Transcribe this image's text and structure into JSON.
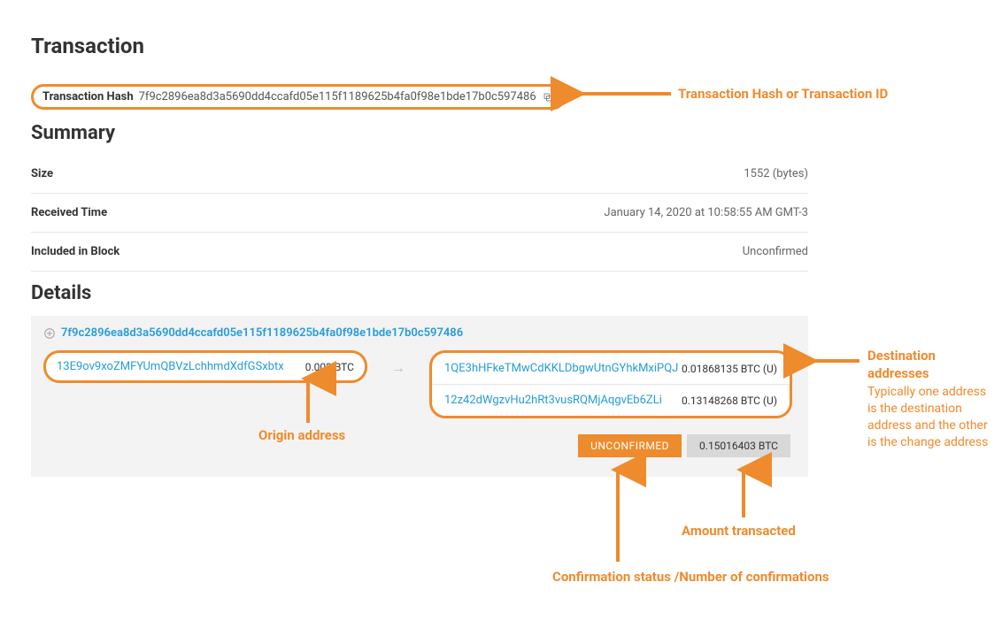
{
  "page_title": "Transaction",
  "hash": {
    "label": "Transaction Hash",
    "value": "7f9c2896ea8d3a5690dd4ccafd05e115f1189625b4fa0f98e1bde17b0c597486"
  },
  "summary": {
    "title": "Summary",
    "rows": [
      {
        "k": "Size",
        "v": "1552 (bytes)"
      },
      {
        "k": "Received Time",
        "v": "January 14, 2020 at 10:58:55 AM GMT-3"
      },
      {
        "k": "Included in Block",
        "v": "Unconfirmed"
      }
    ]
  },
  "details": {
    "title": "Details",
    "tx_link": "7f9c2896ea8d3a5690dd4ccafd05e115f1189625b4fa0f98e1bde17b0c597486",
    "input": {
      "address": "13E9ov9xoZMFYUmQBVzLchhmdXdfGSxbtx",
      "amount": "0.003 BTC"
    },
    "outputs": [
      {
        "address": "1QE3hHFkeTMwCdKKLDbgwUtnGYhkMxiPQJ",
        "amount": "0.01868135 BTC (U)"
      },
      {
        "address": "12z42dWgzvHu2hRt3vusRQMjAqgvEb6ZLi",
        "amount": "0.13148268 BTC (U)"
      }
    ],
    "status_label": "UNCONFIRMED",
    "total_amount": "0.15016403 BTC"
  },
  "callouts": {
    "hash": "Transaction Hash or Transaction ID",
    "origin": "Origin address",
    "dest_title": "Destination addresses",
    "dest_body": "Typically one address is the destination address and the other is the change address",
    "status": "Confirmation status /Number of confirmations",
    "amount": "Amount transacted"
  }
}
